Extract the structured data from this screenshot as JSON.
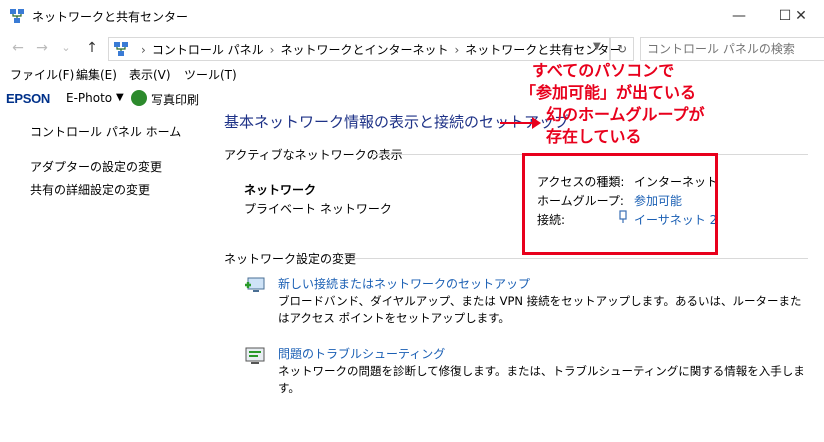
{
  "window": {
    "title": "ネットワークと共有センター",
    "min_glyph": "—",
    "max_glyph": "☐",
    "close_glyph": "✕"
  },
  "nav": {
    "back_glyph": "←",
    "forward_glyph": "→",
    "recent_glyph": "⌄",
    "up_glyph": "↑",
    "breadcrumb": [
      "コントロール パネル",
      "ネットワークとインターネット",
      "ネットワークと共有センター"
    ],
    "breadcrumb_sep": "›",
    "search_placeholder": "コントロール パネルの検索"
  },
  "menu": [
    "ファイル(F)",
    "編集(E)",
    "表示(V)",
    "ツール(T)"
  ],
  "epson": {
    "logo": "EPSON",
    "app": "E-Photo",
    "print_label": "写真印刷"
  },
  "sidebar": {
    "home": "コントロール パネル ホーム",
    "items": [
      "アダプターの設定の変更",
      "共有の詳細設定の変更"
    ]
  },
  "main": {
    "heading": "基本ネットワーク情報の表示と接続のセットアップ",
    "active_section": "アクティブなネットワークの表示",
    "network_name": "ネットワーク",
    "network_type": "プライベート ネットワーク",
    "props": [
      {
        "label": "アクセスの種類:",
        "value": "インターネット"
      },
      {
        "label": "ホームグループ:",
        "value": "参加可能"
      },
      {
        "label": "接続:",
        "value": "イーサネット 2"
      }
    ],
    "change_section": "ネットワーク設定の変更",
    "tasks": [
      {
        "title": "新しい接続またはネットワークのセットアップ",
        "desc": "ブロードバンド、ダイヤルアップ、または VPN 接続をセットアップします。あるいは、ルーターまたはアクセス ポイントをセットアップします。"
      },
      {
        "title": "問題のトラブルシューティング",
        "desc": "ネットワークの問題を診断して修復します。または、トラブルシューティングに関する情報を入手します。"
      }
    ]
  },
  "annotation": {
    "lines": [
      "すべてのパソコンで",
      "「参加可能」が出ている",
      "幻のホームグループが",
      "存在している"
    ],
    "color": "#e8001c"
  }
}
